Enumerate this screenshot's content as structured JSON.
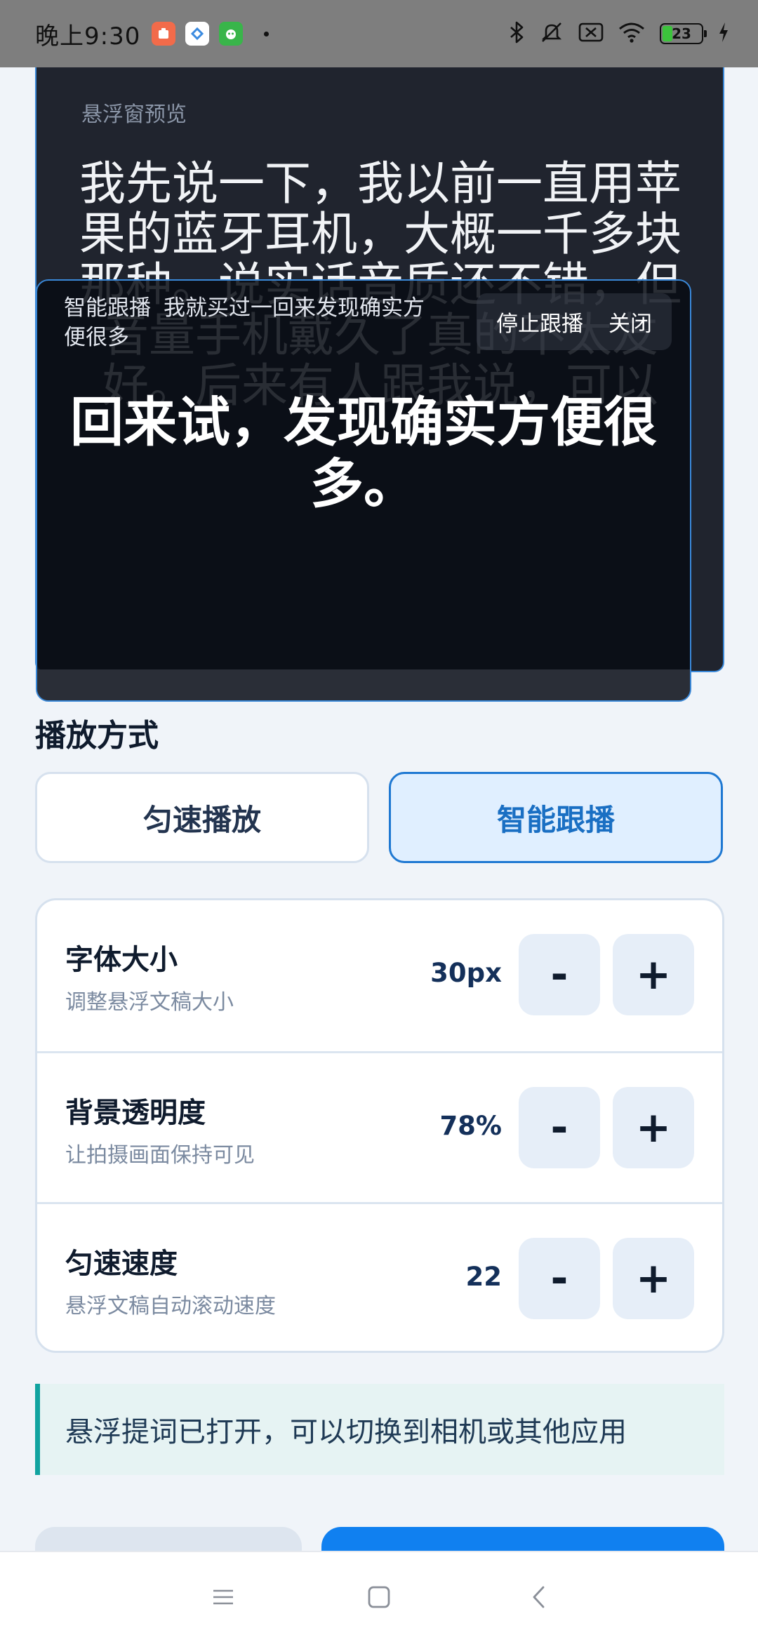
{
  "status_bar": {
    "time": "晚上9:30",
    "battery": "23",
    "icons": [
      "app-icon-orange",
      "app-icon-blue",
      "app-icon-green",
      "dot",
      "bluetooth-icon",
      "mute-icon",
      "sim-icon",
      "wifi-icon",
      "battery-icon",
      "charging-icon"
    ]
  },
  "preview": {
    "label": "悬浮窗预览",
    "text": "我先说一下，我以前一直用苹果的蓝牙耳机，大概一千多块那种。说实话音质还不错，但音量手机戴久了真的不太友好。后来有人跟我说，可以"
  },
  "overlay": {
    "mode": "智能跟播",
    "snippet": "我就买过一回来发现确实方便很多",
    "stop_label": "停止跟播",
    "close_label": "关闭",
    "caption": "回来试，发现确实方便很多。"
  },
  "play_mode": {
    "title": "播放方式",
    "uniform_label": "匀速播放",
    "smart_label": "智能跟播",
    "selected": "智能跟播"
  },
  "settings": [
    {
      "title": "字体大小",
      "subtitle": "调整悬浮文稿大小",
      "value": "30px",
      "minus": "-",
      "plus": "+"
    },
    {
      "title": "背景透明度",
      "subtitle": "让拍摄画面保持可见",
      "value": "78%",
      "minus": "-",
      "plus": "+"
    },
    {
      "title": "匀速速度",
      "subtitle": "悬浮文稿自动滚动速度",
      "value": "22",
      "minus": "-",
      "plus": "+"
    }
  ],
  "notice": "悬浮提词已打开，可以切换到相机或其他应用",
  "colors": {
    "accent": "#1e78d2",
    "primary_button": "#1080f0",
    "notice_bar": "#11a3a0",
    "page_bg": "#f0f4f9"
  }
}
